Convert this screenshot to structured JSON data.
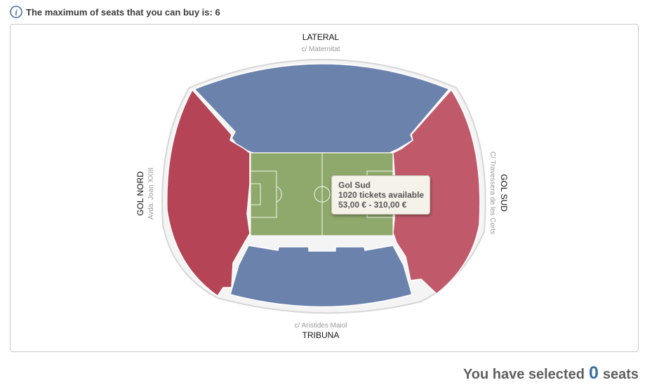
{
  "notice": {
    "icon": "info-icon",
    "text": "The maximum of seats that you can buy is: 6"
  },
  "map": {
    "labels": {
      "top": {
        "name": "LATERAL",
        "street": "c/ Maternitat"
      },
      "bottom": {
        "name": "TRIBUNA",
        "street": "c/ Aristides Maiol"
      },
      "left": {
        "name": "GOL NORD",
        "street": "Avda. Joan XXIII"
      },
      "right": {
        "name": "GOL SUD",
        "street": "C/ Travessera de les Corts"
      }
    },
    "colors": {
      "lateral": "#6b82ad",
      "tribuna": "#6b82ad",
      "gol_nord": "#b54456",
      "gol_sud": "#c05a6b",
      "pitch": "#8fa96c",
      "outline": "#dcdcdc"
    }
  },
  "tooltip": {
    "section": "Gol Sud",
    "availability": "1020 tickets available",
    "price_range": "53,00 € - 310,00 €"
  },
  "selection": {
    "prefix": "You have selected",
    "count": "0",
    "suffix": "seats"
  }
}
